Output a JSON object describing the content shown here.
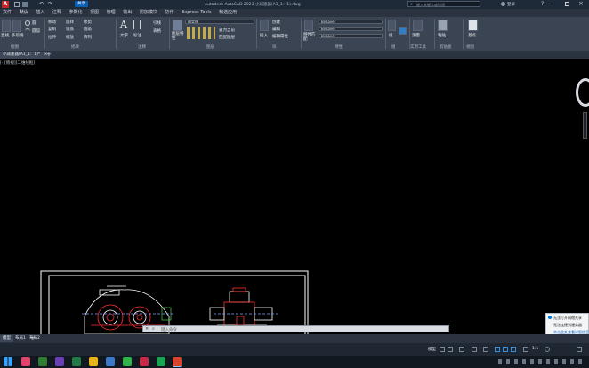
{
  "titlebar": {
    "title": "Autodesk AutoCAD 2023   小减速器(A1_1：1).dwg",
    "share_label": "共享",
    "search_placeholder": "键入关键字或短语",
    "user_label": "登录"
  },
  "menu": [
    "文件",
    "默认",
    "插入",
    "注释",
    "参数化",
    "视图",
    "管理",
    "输出",
    "附加模块",
    "协作",
    "Express Tools",
    "精选应用"
  ],
  "ribbon": {
    "draw_buttons": [
      "直线",
      "多段线",
      "圆",
      "圆弧"
    ],
    "modify_items": [
      "移动",
      "旋转",
      "修剪",
      "复制",
      "镜像",
      "圆角",
      "拉伸",
      "缩放",
      "阵列"
    ],
    "text_label": "文字",
    "dimension_label": "标注",
    "leader_label": "引线",
    "table_label": "表格",
    "layer_props_label": "图层特性",
    "layer_combo": "粗实线",
    "make_current": "置为当前",
    "match_layer": "匹配图层",
    "insert_label": "插入",
    "create_label": "创建",
    "edit_label": "编辑",
    "edit_attr_label": "编辑属性",
    "match_props_label": "特性匹配",
    "bylayer": "ByLayer",
    "group_label": "组",
    "utilities_label": "实用工具",
    "measure_label": "测量",
    "clipboard_label": "剪贴板",
    "paste_label": "粘贴",
    "base_label": "基点",
    "view_label": "视图",
    "groups": [
      "绘图",
      "修改",
      "注释",
      "图层",
      "块",
      "特性",
      "组",
      "实用工具",
      "剪贴板",
      "视图"
    ]
  },
  "doc_tabs": [
    {
      "label": "小减速器(A1_1：1)*",
      "active": true
    }
  ],
  "canvas": {
    "viewport_label": "[-][俯视][二维线框]"
  },
  "command": {
    "placeholder": "键入命令"
  },
  "layout_tabs": [
    "模型",
    "布局1",
    "布局2"
  ],
  "status": {
    "model_label": "模型",
    "scale_label": "1:1"
  },
  "notification": {
    "line1": "无法打开网络共享",
    "line2": "无法连接到服务器",
    "link": "单击此处查看详细信息"
  },
  "colors": {
    "accent": "#0078d7",
    "canvas": "#000000",
    "ribbon": "#3b4453",
    "red": "#ff3030",
    "white": "#ffffff"
  }
}
